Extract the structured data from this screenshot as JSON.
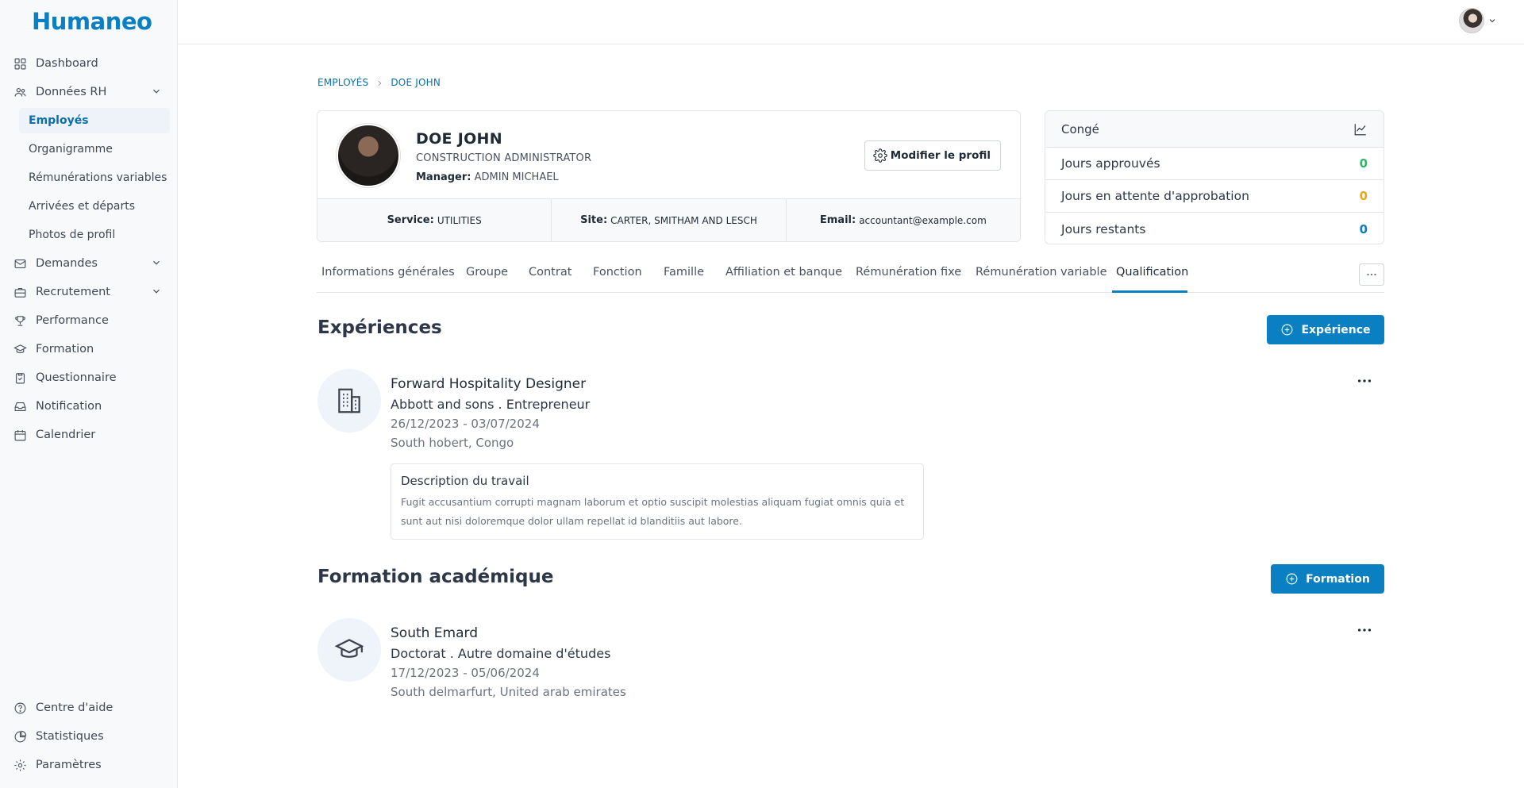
{
  "app": {
    "logo": "Humaneo"
  },
  "sidebar": {
    "items": [
      {
        "label": "Dashboard",
        "icon": "grid-icon"
      },
      {
        "label": "Données RH",
        "icon": "users-icon",
        "expanded": true
      },
      {
        "label": "Demandes",
        "icon": "mail-icon"
      },
      {
        "label": "Recrutement",
        "icon": "briefcase-icon"
      },
      {
        "label": "Performance",
        "icon": "trophy-icon"
      },
      {
        "label": "Formation",
        "icon": "graduation-icon"
      },
      {
        "label": "Questionnaire",
        "icon": "clipboard-icon"
      },
      {
        "label": "Notification",
        "icon": "inbox-icon"
      },
      {
        "label": "Calendrier",
        "icon": "calendar-icon"
      }
    ],
    "sub_items": [
      "Employés",
      "Organigramme",
      "Rémunérations variables",
      "Arrivées et départs",
      "Photos de profil"
    ],
    "bottom": [
      {
        "label": "Centre d'aide",
        "icon": "help-icon"
      },
      {
        "label": "Statistiques",
        "icon": "pie-chart-icon"
      },
      {
        "label": "Paramètres",
        "icon": "gear-icon"
      }
    ]
  },
  "breadcrumb": [
    "EMPLOYÉS",
    "DOE JOHN"
  ],
  "profile": {
    "name": "DOE JOHN",
    "title": "CONSTRUCTION ADMINISTRATOR",
    "manager_label": "Manager:",
    "manager": "ADMIN MICHAEL",
    "edit_label": "Modifier le profil",
    "service_label": "Service:",
    "service": "UTILITIES",
    "site_label": "Site:",
    "site": "CARTER, SMITHAM AND LESCH",
    "email_label": "Email:",
    "email": "accountant@example.com"
  },
  "leave": {
    "title": "Congé",
    "rows": [
      {
        "label": "Jours approuvés",
        "value": "0",
        "color": "#2fb56a"
      },
      {
        "label": "Jours en attente d'approbation",
        "value": "0",
        "color": "#e6a817"
      },
      {
        "label": "Jours restants",
        "value": "0",
        "color": "#0a7fc1"
      }
    ]
  },
  "tabs": [
    "Informations générales",
    "Groupe",
    "Contrat",
    "Fonction",
    "Famille",
    "Affiliation et banque",
    "Rémunération fixe",
    "Rémunération variable",
    "Qualification"
  ],
  "active_tab": "Qualification",
  "experiences": {
    "title": "Expériences",
    "add_label": "Expérience",
    "items": [
      {
        "title": "Forward Hospitality Designer",
        "company": "Abbott and sons . Entrepreneur",
        "dates": "26/12/2023 - 03/07/2024",
        "location": "South hobert, Congo",
        "desc_title": "Description du travail",
        "desc_text": "Fugit accusantium corrupti magnam laborum et optio suscipit molestias aliquam fugiat omnis quia et sunt aut nisi doloremque dolor ullam repellat id blanditiis aut labore."
      }
    ]
  },
  "education": {
    "title": "Formation académique",
    "add_label": "Formation",
    "items": [
      {
        "title": "South Emard",
        "degree": "Doctorat . Autre domaine d'études",
        "dates": "17/12/2023 - 05/06/2024",
        "location": "South delmarfurt, United arab emirates"
      }
    ]
  },
  "colors": {
    "accent": "#0a7fc1"
  }
}
